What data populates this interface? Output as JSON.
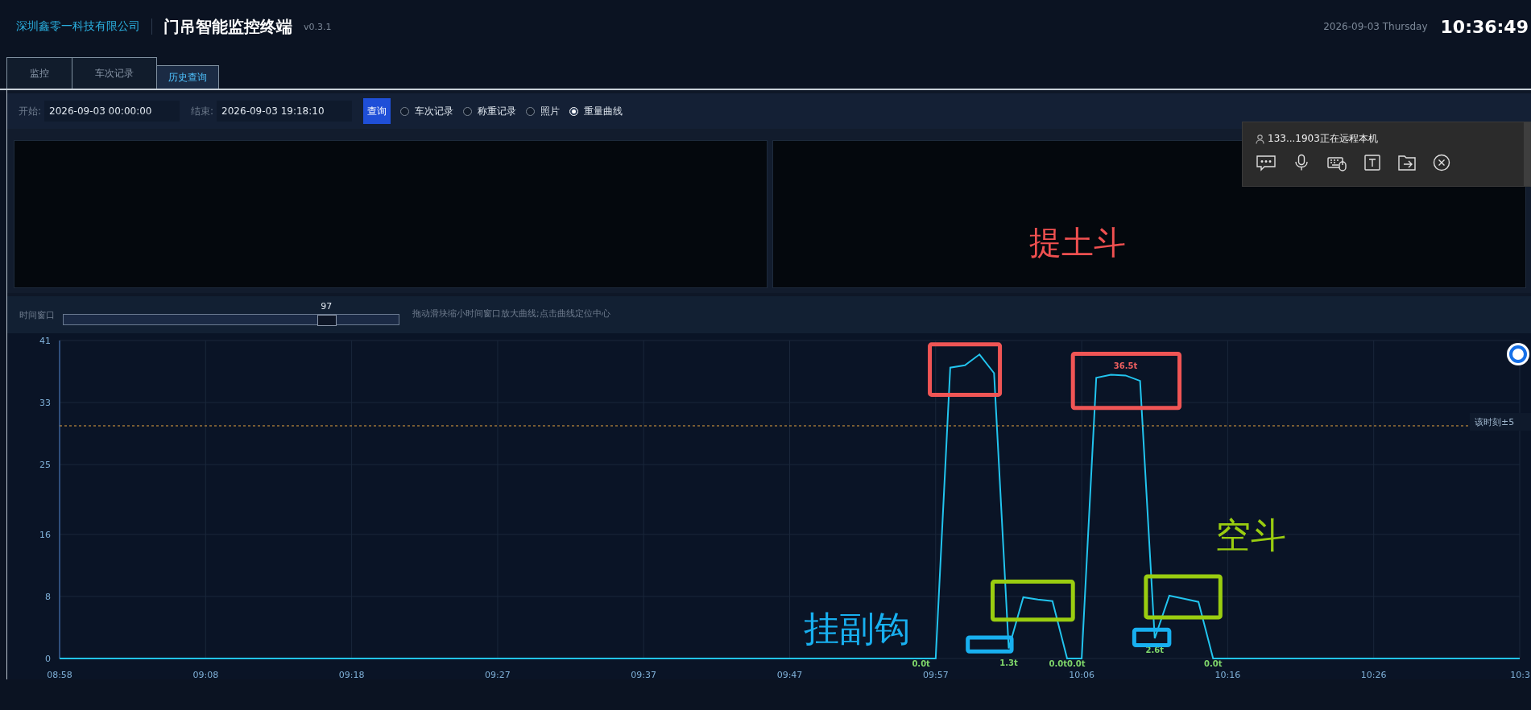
{
  "header": {
    "company": "深圳鑫零一科技有限公司",
    "title": "门吊智能监控终端",
    "version": "v0.3.1",
    "date": "2026-09-03 Thursday",
    "time": "10:36:49"
  },
  "tabs": [
    {
      "label": "监控",
      "selected": false
    },
    {
      "label": "车次记录",
      "selected": false
    },
    {
      "label": "历史查询",
      "selected": true
    }
  ],
  "query": {
    "start_label": "开始:",
    "start_value": "2026-09-03 00:00:00",
    "end_label": "结束:",
    "end_value": "2026-09-03 19:18:10",
    "button": "查询",
    "options": [
      {
        "label": "车次记录",
        "selected": false
      },
      {
        "label": "称重记录",
        "selected": false
      },
      {
        "label": "照片",
        "selected": false
      },
      {
        "label": "重量曲线",
        "selected": true
      }
    ]
  },
  "video_panels": [
    {
      "kind": "video"
    },
    {
      "kind": "video",
      "overlay_text": "提土斗"
    }
  ],
  "time_window": {
    "label": "时间窗口",
    "value": "97",
    "level": 0.8,
    "hint": "拖动滑块缩小时间窗口放大曲线;点击曲线定位中心"
  },
  "chart": {
    "chart_data": {
      "type": "line",
      "ylim": [
        0,
        41
      ],
      "yticks": [
        0,
        8,
        16,
        25,
        33,
        41
      ],
      "categories": [
        "08:58",
        null,
        null,
        null,
        null,
        null,
        null,
        null,
        null,
        null,
        "09:08",
        null,
        null,
        null,
        null,
        null,
        null,
        null,
        null,
        null,
        "09:18",
        null,
        null,
        null,
        null,
        null,
        null,
        null,
        null,
        null,
        "09:27",
        null,
        null,
        null,
        null,
        null,
        null,
        null,
        null,
        null,
        "09:37",
        null,
        null,
        null,
        null,
        null,
        null,
        null,
        null,
        null,
        "09:47",
        null,
        null,
        null,
        null,
        null,
        null,
        null,
        null,
        null,
        "09:57",
        null,
        null,
        null,
        null,
        null,
        null,
        null,
        null,
        null,
        "10:06",
        null,
        null,
        null,
        null,
        null,
        null,
        null,
        null,
        null,
        "10:16",
        null,
        null,
        null,
        null,
        null,
        null,
        null,
        null,
        null,
        "10:26",
        null,
        null,
        null,
        null,
        null,
        null,
        null,
        null,
        null,
        "10:3"
      ],
      "series": [
        {
          "color": "#22c4ee",
          "values": [
            0,
            0,
            0,
            0,
            0,
            0,
            0,
            0,
            0,
            0,
            0,
            0,
            0,
            0,
            0,
            0,
            0,
            0,
            0,
            0,
            0,
            0,
            0,
            0,
            0,
            0,
            0,
            0,
            0,
            0,
            0,
            0,
            0,
            0,
            0,
            0,
            0,
            0,
            0,
            0,
            0,
            0,
            0,
            0,
            0,
            0,
            0,
            0,
            0,
            0,
            0,
            0,
            0,
            0,
            0,
            0,
            0,
            0,
            0,
            0,
            0,
            37.5,
            37.8,
            39.2,
            36.8,
            1.3,
            7.9,
            7.6,
            7.4,
            0,
            0,
            36.2,
            36.6,
            36.5,
            35.8,
            2.6,
            8.1,
            7.7,
            7.3,
            0,
            0,
            0,
            0,
            0,
            0,
            0,
            0,
            0,
            0,
            0,
            0,
            0,
            0,
            0,
            0,
            0,
            0,
            0,
            0,
            0,
            0
          ]
        }
      ],
      "value_labels": [
        null,
        null,
        null,
        null,
        null,
        null,
        null,
        null,
        null,
        null,
        null,
        null,
        null,
        null,
        null,
        null,
        null,
        null,
        null,
        null,
        null,
        null,
        null,
        null,
        null,
        null,
        null,
        null,
        null,
        null,
        null,
        null,
        null,
        null,
        null,
        null,
        null,
        null,
        null,
        null,
        null,
        null,
        null,
        null,
        null,
        null,
        null,
        null,
        null,
        null,
        null,
        null,
        null,
        null,
        null,
        null,
        null,
        null,
        null,
        "0.0t",
        null,
        null,
        null,
        null,
        null,
        "1.3t",
        null,
        null,
        null,
        "0.0t0.0t",
        null,
        null,
        null,
        "36.5t",
        null,
        "2.6t",
        null,
        null,
        null,
        "0.0t",
        null,
        null,
        null,
        null,
        null,
        null,
        null,
        null,
        null,
        null,
        null,
        null,
        null,
        null,
        null,
        null,
        null,
        null,
        null,
        null,
        null
      ],
      "grid": true
    },
    "threshold": {
      "label": "该时刻±5"
    },
    "markup": [
      {
        "kind": "box",
        "color": "#f05555"
      },
      {
        "kind": "box",
        "color": "#f05555"
      },
      {
        "kind": "box",
        "color": "#9acd10"
      },
      {
        "kind": "box",
        "color": "#9acd10"
      },
      {
        "kind": "box",
        "color": "#18b0f0"
      },
      {
        "kind": "box",
        "color": "#18b0f0"
      },
      {
        "kind": "callout",
        "text": "挂副钩",
        "color": "#18b0f0"
      },
      {
        "kind": "callout",
        "text": "空斗",
        "color": "#9acd10"
      }
    ]
  },
  "remote": {
    "text": "133...1903正在远程本机"
  }
}
